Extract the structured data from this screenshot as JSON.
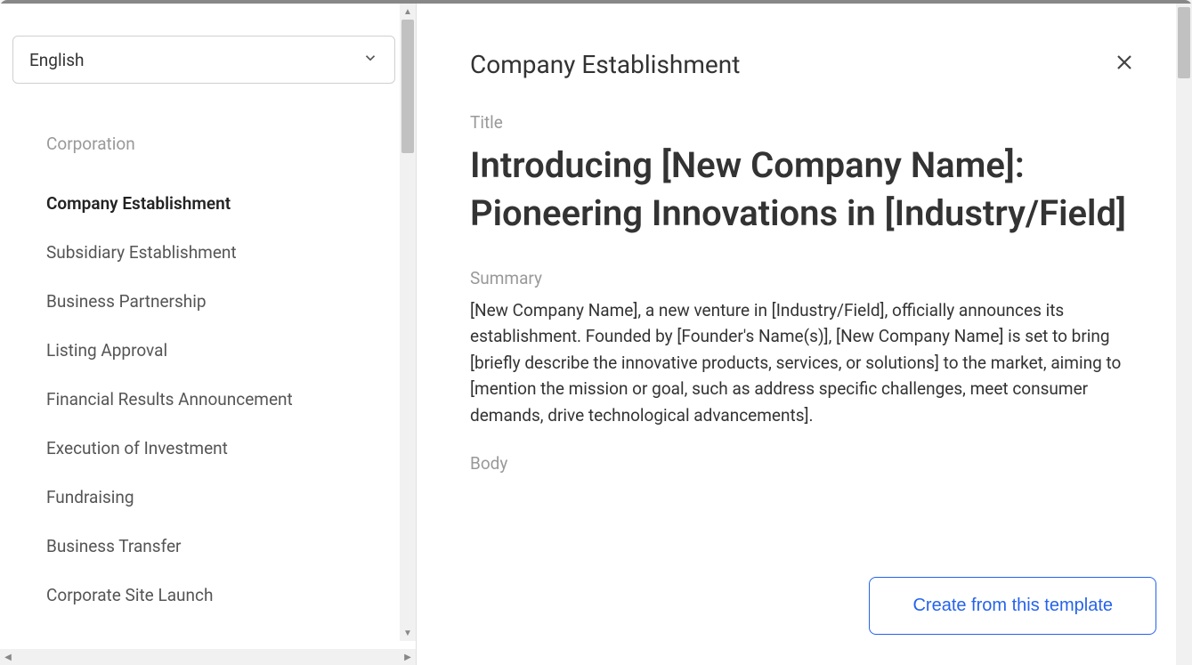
{
  "languageSelector": {
    "selected": "English"
  },
  "sidebar": {
    "categoryHeader": "Corporation",
    "items": [
      {
        "label": "Company Establishment",
        "active": true
      },
      {
        "label": "Subsidiary Establishment",
        "active": false
      },
      {
        "label": "Business Partnership",
        "active": false
      },
      {
        "label": "Listing Approval",
        "active": false
      },
      {
        "label": "Financial Results Announcement",
        "active": false
      },
      {
        "label": "Execution of Investment",
        "active": false
      },
      {
        "label": "Fundraising",
        "active": false
      },
      {
        "label": "Business Transfer",
        "active": false
      },
      {
        "label": "Corporate Site Launch",
        "active": false
      }
    ]
  },
  "main": {
    "headerTitle": "Company Establishment",
    "titleLabel": "Title",
    "titleText": "Introducing [New Company Name]: Pioneering Innovations in [Industry/Field]",
    "summaryLabel": "Summary",
    "summaryText": "[New Company Name], a new venture in [Industry/Field], officially announces its establishment. Founded by [Founder's Name(s)], [New Company Name] is set to bring [briefly describe the innovative products, services, or solutions] to the market, aiming to [mention the mission or goal, such as address specific challenges, meet consumer demands, drive technological advancements].",
    "bodyLabel": "Body",
    "createButtonLabel": "Create from this template"
  }
}
